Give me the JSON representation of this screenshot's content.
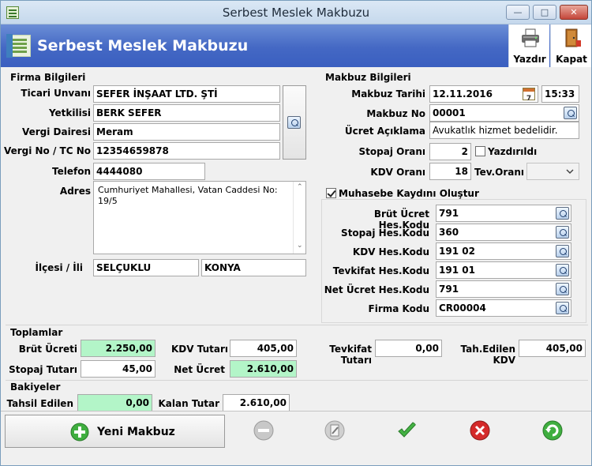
{
  "window": {
    "title": "Serbest Meslek Makbuzu"
  },
  "header": {
    "title": "Serbest Meslek Makbuzu",
    "print_label": "Yazdır",
    "close_label": "Kapat"
  },
  "firma": {
    "section_label": "Firma Bilgileri",
    "ticari_unvan_label": "Ticari Unvanı",
    "ticari_unvan": "SEFER İNŞAAT LTD. ŞTİ",
    "yetkili_label": "Yetkilisi",
    "yetkili": "BERK SEFER",
    "vergi_dairesi_label": "Vergi Dairesi",
    "vergi_dairesi": "Meram",
    "vergi_no_label": "Vergi No / TC No",
    "vergi_no": "12354659878",
    "telefon_label": "Telefon",
    "telefon": "4444080",
    "adres_label": "Adres",
    "adres": "Cumhuriyet Mahallesi, Vatan Caddesi No: 19/5",
    "ilce_il_label": "İlçesi / İli",
    "ilce": "SELÇUKLU",
    "il": "KONYA"
  },
  "makbuz": {
    "section_label": "Makbuz Bilgileri",
    "tarih_label": "Makbuz Tarihi",
    "tarih": "12.11.2016",
    "saat": "15:33",
    "calendar_day": "7",
    "no_label": "Makbuz No",
    "no": "00001",
    "aciklama_label": "Ücret Açıklama",
    "aciklama": "Avukatlık hizmet bedelidir.",
    "stopaj_orani_label": "Stopaj Oranı",
    "stopaj_orani": "2",
    "yazdirildi_label": "Yazdırıldı",
    "kdv_orani_label": "KDV Oranı",
    "kdv_orani": "18",
    "tev_orani_label": "Tev.Oranı",
    "tev_orani": ""
  },
  "muhasebe": {
    "checkbox_label": "Muhasebe Kaydını Oluştur",
    "brut_label": "Brüt Ücret Hes.Kodu",
    "brut": "791",
    "stopaj_label": "Stopaj Hes.Kodu",
    "stopaj": "360",
    "kdv_label": "KDV Hes.Kodu",
    "kdv": "191 02",
    "tevkifat_label": "Tevkifat Hes.Kodu",
    "tevkifat": "191 01",
    "net_label": "Net Ücret Hes.Kodu",
    "net": "791",
    "firma_kodu_label": "Firma Kodu",
    "firma_kodu": "CR00004"
  },
  "toplamlar": {
    "section_label": "Toplamlar",
    "brut_label": "Brüt Ücreti",
    "brut": "2.250,00",
    "kdv_label": "KDV Tutarı",
    "kdv": "405,00",
    "tevkifat_label": "Tevkifat Tutarı",
    "tevkifat": "0,00",
    "tah_kdv_label": "Tah.Edilen KDV",
    "tah_kdv": "405,00",
    "stopaj_label": "Stopaj Tutarı",
    "stopaj": "45,00",
    "net_label": "Net Ücret",
    "net": "2.610,00"
  },
  "bakiyeler": {
    "section_label": "Bakiyeler",
    "tahsil_label": "Tahsil Edilen",
    "tahsil": "0,00",
    "kalan_label": "Kalan Tutar",
    "kalan": "2.610,00"
  },
  "actions": {
    "new_label": "Yeni Makbuz"
  },
  "colors": {
    "header": "#4468c4",
    "green_field": "#b3f5c8",
    "check": "#3fb13f",
    "delete": "#d42a2a"
  }
}
